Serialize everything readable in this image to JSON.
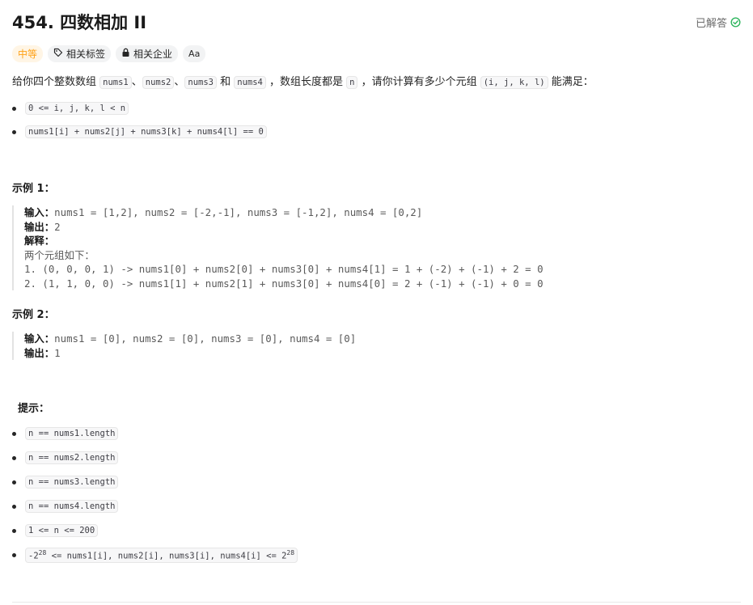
{
  "problem": {
    "title": "454. 四数相加 II",
    "status": "已解答",
    "tags": {
      "difficulty": "中等",
      "related_tags": "相关标签",
      "related_companies": "相关企业",
      "font_toggle": "Aa"
    },
    "description": {
      "t1": "给你四个整数数组 ",
      "c1": "nums1",
      "t2": "、",
      "c2": "nums2",
      "t3": "、",
      "c3": "nums3",
      "t4": " 和 ",
      "c4": "nums4",
      "t5": " ，数组长度都是 ",
      "c5": "n",
      "t6": " ，请你计算有多少个元组 ",
      "c6": "(i, j, k, l)",
      "t7": " 能满足："
    },
    "conditions": [
      "0 <= i, j, k, l < n",
      "nums1[i] + nums2[j] + nums3[k] + nums4[l] == 0"
    ],
    "example1": {
      "heading": "示例 1：",
      "input_label": "输入：",
      "input_value": "nums1 = [1,2], nums2 = [-2,-1], nums3 = [-1,2], nums4 = [0,2]",
      "output_label": "输出：",
      "output_value": "2",
      "explain_label": "解释：",
      "explain_line1": "两个元组如下：",
      "explain_line2": "1. (0, 0, 0, 1) -> nums1[0] + nums2[0] + nums3[0] + nums4[1] = 1 + (-2) + (-1) + 2 = 0",
      "explain_line3": "2. (1, 1, 0, 0) -> nums1[1] + nums2[1] + nums3[0] + nums4[0] = 2 + (-1) + (-1) + 0 = 0"
    },
    "example2": {
      "heading": "示例 2：",
      "input_label": "输入：",
      "input_value": "nums1 = [0], nums2 = [0], nums3 = [0], nums4 = [0]",
      "output_label": "输出：",
      "output_value": "1"
    },
    "hints": {
      "heading": "提示：",
      "items": [
        "n == nums1.length",
        "n == nums2.length",
        "n == nums3.length",
        "n == nums4.length",
        "1 <= n <= 200"
      ],
      "last": {
        "p1": "-2",
        "e1": "28",
        "p2": " <= nums1[i], nums2[i], nums3[i], nums4[i] <= 2",
        "e2": "28"
      }
    },
    "colors": {
      "accent_orange": "#ffa116",
      "solved_green": "#2db55d"
    }
  }
}
